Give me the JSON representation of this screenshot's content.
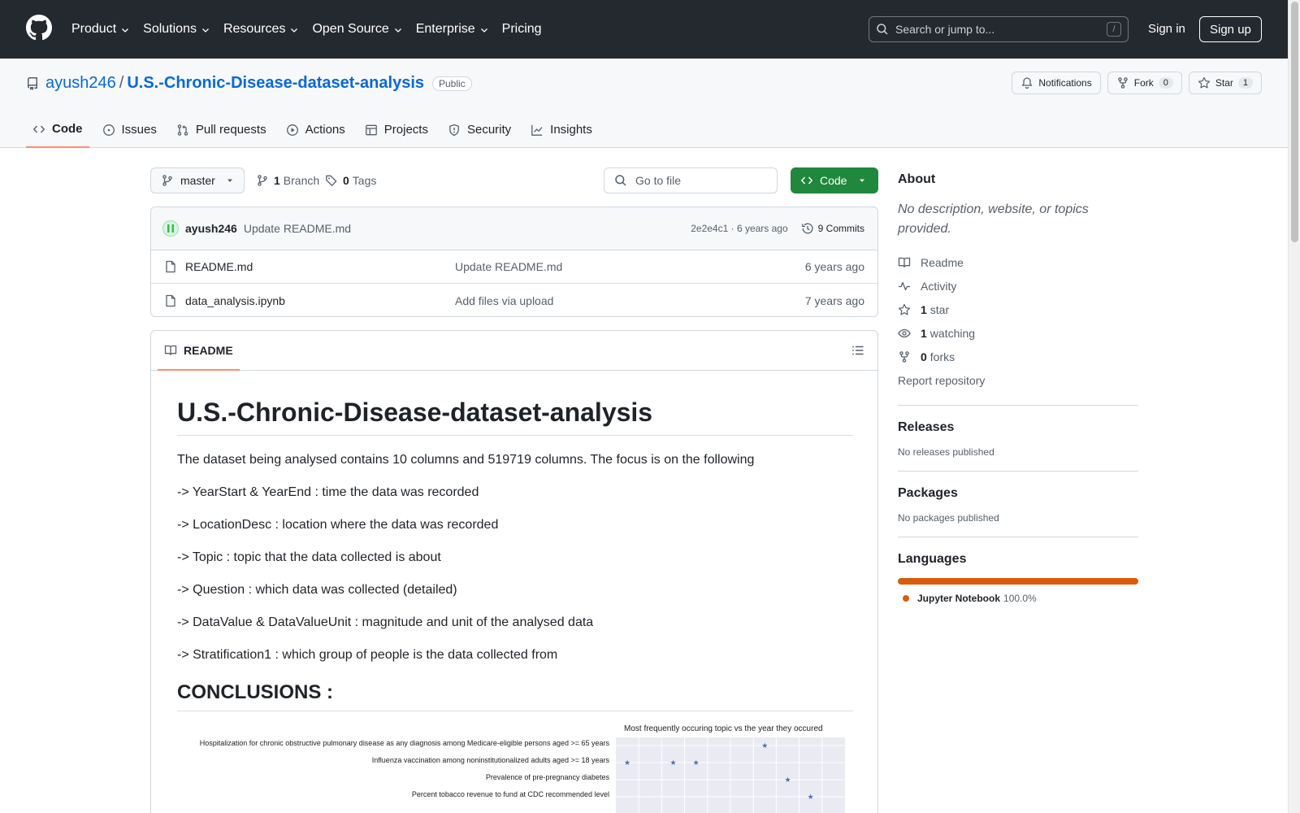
{
  "header": {
    "nav": [
      "Product",
      "Solutions",
      "Resources",
      "Open Source",
      "Enterprise",
      "Pricing"
    ],
    "search_placeholder": "Search or jump to...",
    "search_key": "/",
    "signin": "Sign in",
    "signup": "Sign up"
  },
  "repo": {
    "owner": "ayush246",
    "separator": "/",
    "name": "U.S.-Chronic-Disease-dataset-analysis",
    "visibility": "Public",
    "notifications_label": "Notifications",
    "fork_label": "Fork",
    "fork_count": "0",
    "star_label": "Star",
    "star_count": "1",
    "tabs": [
      "Code",
      "Issues",
      "Pull requests",
      "Actions",
      "Projects",
      "Security",
      "Insights"
    ]
  },
  "files": {
    "branch": "master",
    "branch_count": "1",
    "branch_label": "Branch",
    "tag_count": "0",
    "tag_label": "Tags",
    "goto_placeholder": "Go to file",
    "code_button": "Code",
    "last_commit": {
      "author": "ayush246",
      "message": "Update README.md",
      "hash": "2e2e4c1",
      "age": "6 years ago",
      "commits": "9 Commits"
    },
    "rows": [
      {
        "name": "README.md",
        "message": "Update README.md",
        "age": "6 years ago"
      },
      {
        "name": "data_analysis.ipynb",
        "message": "Add files via upload",
        "age": "7 years ago"
      }
    ]
  },
  "readme": {
    "tab_label": "README",
    "title": "U.S.-Chronic-Disease-dataset-analysis",
    "paragraphs": [
      "The dataset being analysed contains 10 columns and 519719 columns. The focus is on the following",
      "-> YearStart & YearEnd : time the data was recorded",
      "-> LocationDesc : location where the data was recorded",
      "-> Topic : topic that the data collected is about",
      "-> Question : which data was collected (detailed)",
      "-> DataValue & DataValueUnit : magnitude and unit of the analysed data",
      "-> Stratification1 : which group of people is the data collected from"
    ],
    "conclusions_heading": "CONCLUSIONS :",
    "chart_title": "Most frequently occuring topic vs the year they occured",
    "chart_categories": [
      "Hospitalization for chronic obstructive pulmonary disease as any diagnosis among Medicare-eligible persons aged >= 65 years",
      "Influenza vaccination among noninstitutionalized adults aged >= 18 years",
      "Prevalence of pre-pregnancy diabetes",
      "Percent tobacco revenue to fund at CDC recommended level"
    ]
  },
  "chart_data": {
    "type": "scatter",
    "title": "Most frequently occuring topic vs the year they occured",
    "categories": [
      "Hospitalization for chronic obstructive pulmonary disease as any diagnosis among Medicare-eligible persons aged >= 65 years",
      "Influenza vaccination among noninstitutionalized adults aged >= 18 years",
      "Prevalence of pre-pregnancy diabetes",
      "Percent tobacco revenue to fund at CDC recommended level"
    ],
    "points": [
      {
        "category_index": 0,
        "column": 6
      },
      {
        "category_index": 1,
        "column": 0
      },
      {
        "category_index": 1,
        "column": 2
      },
      {
        "category_index": 1,
        "column": 3
      },
      {
        "category_index": 2,
        "column": 7
      },
      {
        "category_index": 3,
        "column": 8
      }
    ],
    "columns": 10,
    "marker": "star",
    "marker_color": "#4c72b0",
    "grid": true
  },
  "sidebar": {
    "about_heading": "About",
    "about_desc": "No description, website, or topics provided.",
    "readme": "Readme",
    "activity": "Activity",
    "stars_count": "1",
    "stars_label": "star",
    "watching_count": "1",
    "watching_label": "watching",
    "forks_count": "0",
    "forks_label": "forks",
    "report": "Report repository",
    "releases_heading": "Releases",
    "releases_text": "No releases published",
    "packages_heading": "Packages",
    "packages_text": "No packages published",
    "languages_heading": "Languages",
    "language_name": "Jupyter Notebook",
    "language_pct": "100.0%",
    "language_color": "#DA5B0B"
  }
}
